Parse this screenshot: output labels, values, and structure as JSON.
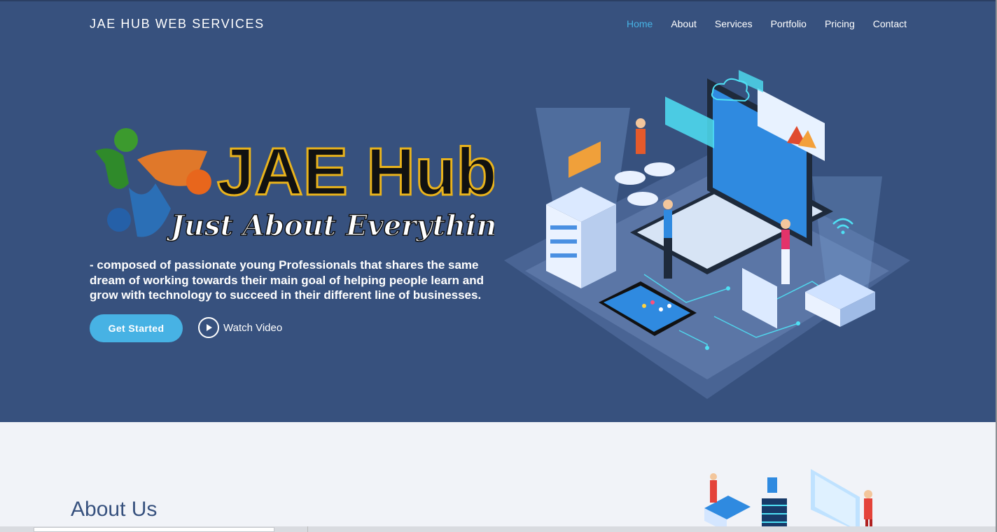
{
  "header": {
    "brand": "JAE HUB WEB SERVICES",
    "nav": [
      {
        "label": "Home",
        "active": true
      },
      {
        "label": "About",
        "active": false
      },
      {
        "label": "Services",
        "active": false
      },
      {
        "label": "Portfolio",
        "active": false
      },
      {
        "label": "Pricing",
        "active": false
      },
      {
        "label": "Contact",
        "active": false
      }
    ]
  },
  "hero": {
    "logo_title": "JAE Hub",
    "logo_subtitle": "Just About Everything",
    "tagline": "- composed of passionate young Professionals that shares the same dream of working towards their main goal of helping people learn and grow with technology to succeed in their different line of businesses.",
    "cta_label": "Get Started",
    "video_label": "Watch Video"
  },
  "about": {
    "title": "About Us"
  },
  "colors": {
    "hero_bg": "#37517e",
    "accent": "#47b2e4",
    "section_bg": "#f1f3f8"
  }
}
